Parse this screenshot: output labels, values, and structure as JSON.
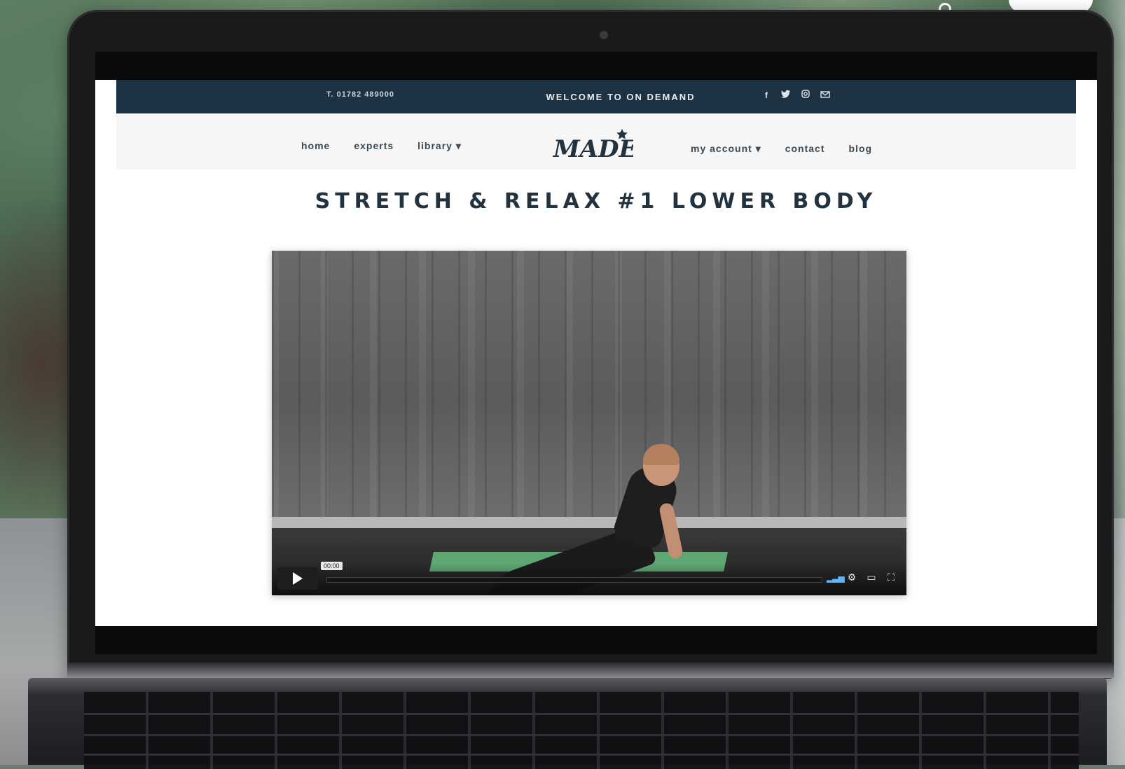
{
  "site": {
    "topbar": {
      "phone": "T. 01782 489000",
      "welcome": "WELCOME TO ON DEMAND",
      "social_icons": [
        "facebook-icon",
        "twitter-icon",
        "instagram-icon",
        "email-icon"
      ]
    },
    "nav": {
      "left": [
        {
          "label": "home"
        },
        {
          "label": "experts"
        },
        {
          "label": "library ▾"
        }
      ],
      "right": [
        {
          "label": "my account ▾"
        },
        {
          "label": "contact"
        },
        {
          "label": "blog"
        }
      ],
      "logo_text": "MADE"
    },
    "page_title": "STRETCH & RELAX #1 LOWER BODY",
    "video": {
      "time_label": "00:00",
      "progress_fraction": 0.0,
      "icons": [
        "volume-icon",
        "settings-icon",
        "airplay-icon",
        "fullscreen-icon"
      ]
    }
  },
  "colors": {
    "topbar_bg": "#1d3344",
    "title_text": "#22323f",
    "progress_accent": "#59b7ff",
    "mat_green": "#5fa772"
  }
}
